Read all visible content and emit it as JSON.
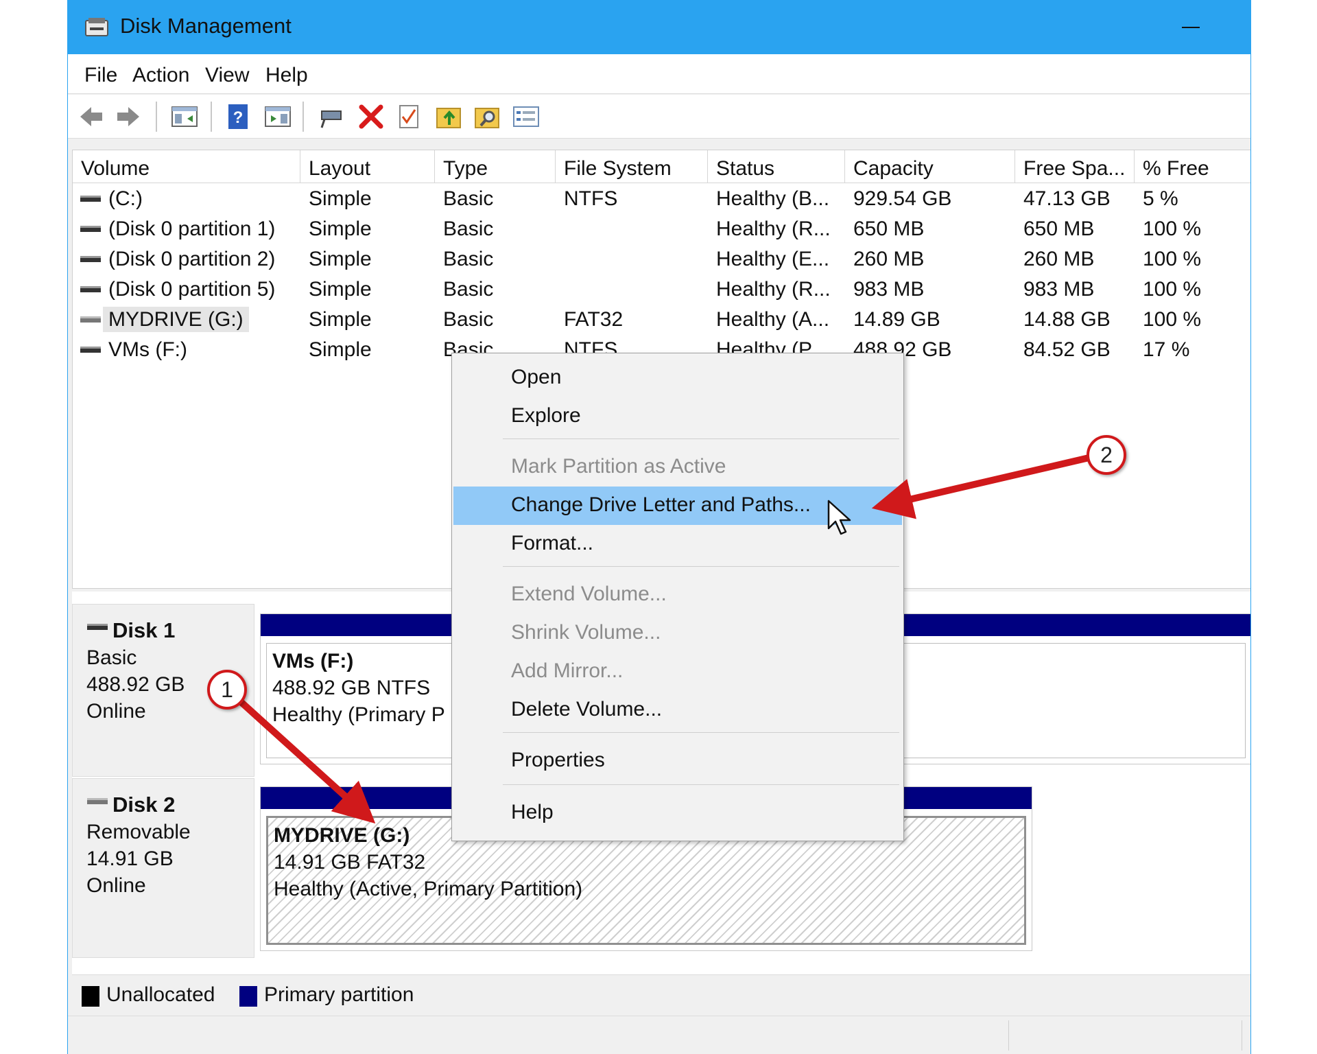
{
  "window": {
    "title": "Disk Management"
  },
  "menubar": {
    "items": [
      "File",
      "Action",
      "View",
      "Help"
    ]
  },
  "toolbar": {
    "icons": [
      "back-icon",
      "forward-icon",
      "console-tree-icon",
      "help-icon",
      "show-hide-icon",
      "connect-icon",
      "delete-icon",
      "check-icon",
      "up-folder-icon",
      "search-folder-icon",
      "properties-icon"
    ]
  },
  "volumes": {
    "headers": [
      "Volume",
      "Layout",
      "Type",
      "File System",
      "Status",
      "Capacity",
      "Free Spa...",
      "% Free"
    ],
    "rows": [
      {
        "volume": " (C:)",
        "layout": "Simple",
        "type": "Basic",
        "fs": "NTFS",
        "status": "Healthy (B...",
        "capacity": "929.54 GB",
        "free": "47.13 GB",
        "pct": "5 %"
      },
      {
        "volume": "(Disk 0 partition 1)",
        "layout": "Simple",
        "type": "Basic",
        "fs": "",
        "status": "Healthy (R...",
        "capacity": "650 MB",
        "free": "650 MB",
        "pct": "100 %"
      },
      {
        "volume": "(Disk 0 partition 2)",
        "layout": "Simple",
        "type": "Basic",
        "fs": "",
        "status": "Healthy (E...",
        "capacity": "260 MB",
        "free": "260 MB",
        "pct": "100 %"
      },
      {
        "volume": "(Disk 0 partition 5)",
        "layout": "Simple",
        "type": "Basic",
        "fs": "",
        "status": "Healthy (R...",
        "capacity": "983 MB",
        "free": "983 MB",
        "pct": "100 %"
      },
      {
        "volume": "MYDRIVE (G:)",
        "layout": "Simple",
        "type": "Basic",
        "fs": "FAT32",
        "status": "Healthy (A...",
        "capacity": "14.89 GB",
        "free": "14.88 GB",
        "pct": "100 %",
        "selected": true
      },
      {
        "volume": "VMs (F:)",
        "layout": "Simple",
        "type": "Basic",
        "fs": "NTFS",
        "status": "Healthy (P...",
        "capacity": "488.92 GB",
        "free": "84.52 GB",
        "pct": "17 %"
      }
    ]
  },
  "disks": [
    {
      "name": "Disk 1",
      "kind": "Basic",
      "size": "488.92 GB",
      "state": "Online",
      "partition": {
        "name": "VMs  (F:)",
        "size_fs": "488.92 GB NTFS",
        "status": "Healthy (Primary P"
      }
    },
    {
      "name": "Disk 2",
      "kind": "Removable",
      "size": "14.91 GB",
      "state": "Online",
      "partition": {
        "name": "MYDRIVE  (G:)",
        "size_fs": "14.91 GB FAT32",
        "status": "Healthy (Active, Primary Partition)"
      }
    }
  ],
  "legend": {
    "unallocated": "Unallocated",
    "primary": "Primary partition",
    "unallocated_color": "#000000",
    "primary_color": "#000080"
  },
  "context_menu": {
    "items": [
      {
        "label": "Open",
        "state": "enabled"
      },
      {
        "label": "Explore",
        "state": "enabled"
      },
      {
        "label": "Mark Partition as Active",
        "state": "disabled"
      },
      {
        "label": "Change Drive Letter and Paths...",
        "state": "highlighted"
      },
      {
        "label": "Format...",
        "state": "enabled"
      },
      {
        "label": "Extend Volume...",
        "state": "disabled"
      },
      {
        "label": "Shrink Volume...",
        "state": "disabled"
      },
      {
        "label": "Add Mirror...",
        "state": "disabled"
      },
      {
        "label": "Delete Volume...",
        "state": "enabled"
      },
      {
        "label": "Properties",
        "state": "enabled"
      },
      {
        "label": "Help",
        "state": "enabled"
      }
    ]
  },
  "callouts": [
    "1",
    "2"
  ],
  "colors": {
    "titlebar": "#2aa3f0",
    "menu_highlight": "#91c9f7",
    "arrow": "#d0191b",
    "partition_bar": "#000080"
  }
}
